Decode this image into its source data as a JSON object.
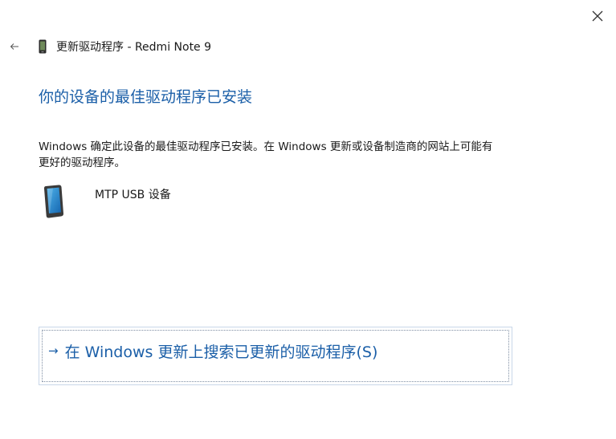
{
  "window": {
    "title": "更新驱动程序 - Redmi Note 9",
    "close_icon": "close-icon",
    "back_icon": "back-arrow-icon",
    "title_icon": "phone-icon"
  },
  "main": {
    "heading": "你的设备的最佳驱动程序已安装",
    "description_line1": "Windows 确定此设备的最佳驱动程序已安装。在 Windows 更新或设备制造商的网站上可能有",
    "description_line2": "更好的驱动程序。",
    "device": {
      "icon": "phone-icon",
      "name": "MTP USB 设备"
    },
    "search_link": {
      "arrow": "→",
      "label": "在 Windows 更新上搜索已更新的驱动程序(S)"
    }
  },
  "colors": {
    "accent": "#1b5fa8",
    "text": "#1a1a1a",
    "background": "#ffffff"
  }
}
